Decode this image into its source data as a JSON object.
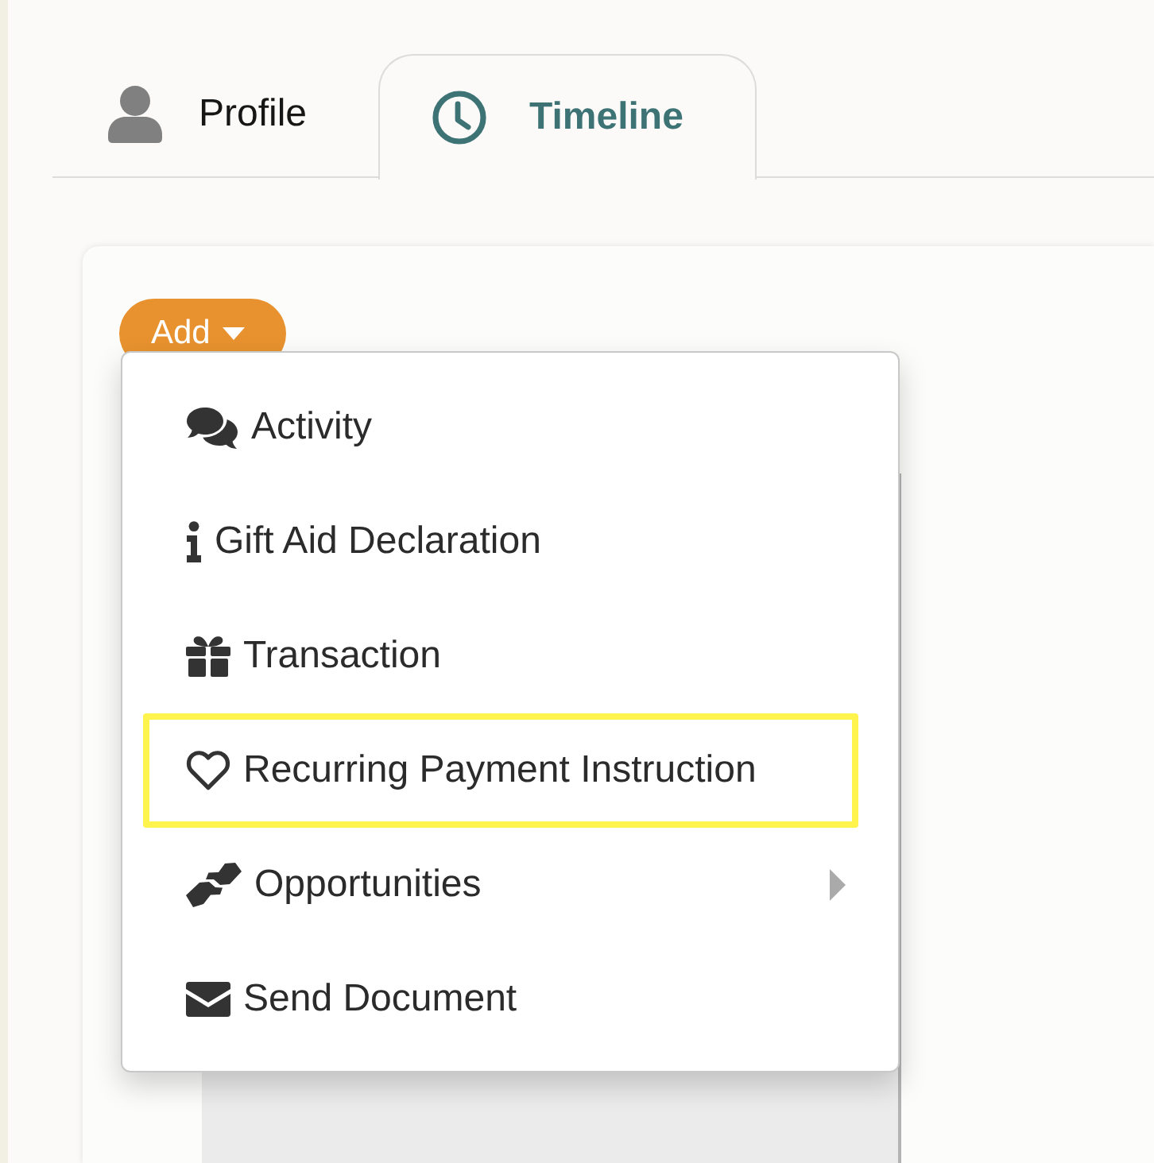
{
  "tabs": [
    {
      "label": "Profile",
      "selected": false
    },
    {
      "label": "Timeline",
      "selected": true
    }
  ],
  "add_button": {
    "label": "Add"
  },
  "menu": {
    "items": [
      {
        "label": "Activity",
        "highlighted": false,
        "submenu": false
      },
      {
        "label": "Gift Aid Declaration",
        "highlighted": false,
        "submenu": false
      },
      {
        "label": "Transaction",
        "highlighted": false,
        "submenu": false
      },
      {
        "label": "Recurring Payment Instruction",
        "highlighted": true,
        "submenu": false
      },
      {
        "label": "Opportunities",
        "highlighted": false,
        "submenu": true
      },
      {
        "label": "Send Document",
        "highlighted": false,
        "submenu": false
      }
    ]
  }
}
